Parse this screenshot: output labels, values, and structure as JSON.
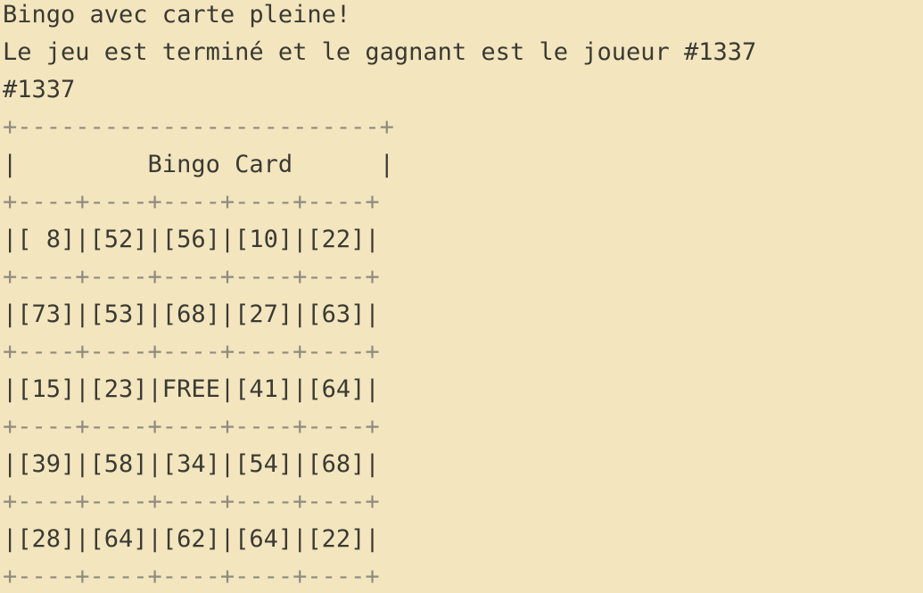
{
  "console": {
    "messages": [
      "Bingo avec carte pleine!",
      "Le jeu est terminé et le gagnant est le joueur #1337",
      "#1337"
    ],
    "card": {
      "top_border": "+-------------------------+",
      "title_row": "|         Bingo Card      |",
      "separator": "+----+----+----+----+----+",
      "rows": [
        "|[ 8]|[52]|[56]|[10]|[22]|",
        "|[73]|[53]|[68]|[27]|[63]|",
        "|[15]|[23]|FREE|[41]|[64]|",
        "|[39]|[58]|[34]|[54]|[68]|",
        "|[28]|[64]|[62]|[64]|[22]|"
      ],
      "numbers": [
        [
          8,
          52,
          56,
          10,
          22
        ],
        [
          73,
          53,
          68,
          27,
          63
        ],
        [
          15,
          23,
          "FREE",
          41,
          64
        ],
        [
          39,
          58,
          34,
          54,
          68
        ],
        [
          28,
          64,
          62,
          64,
          22
        ]
      ]
    }
  }
}
